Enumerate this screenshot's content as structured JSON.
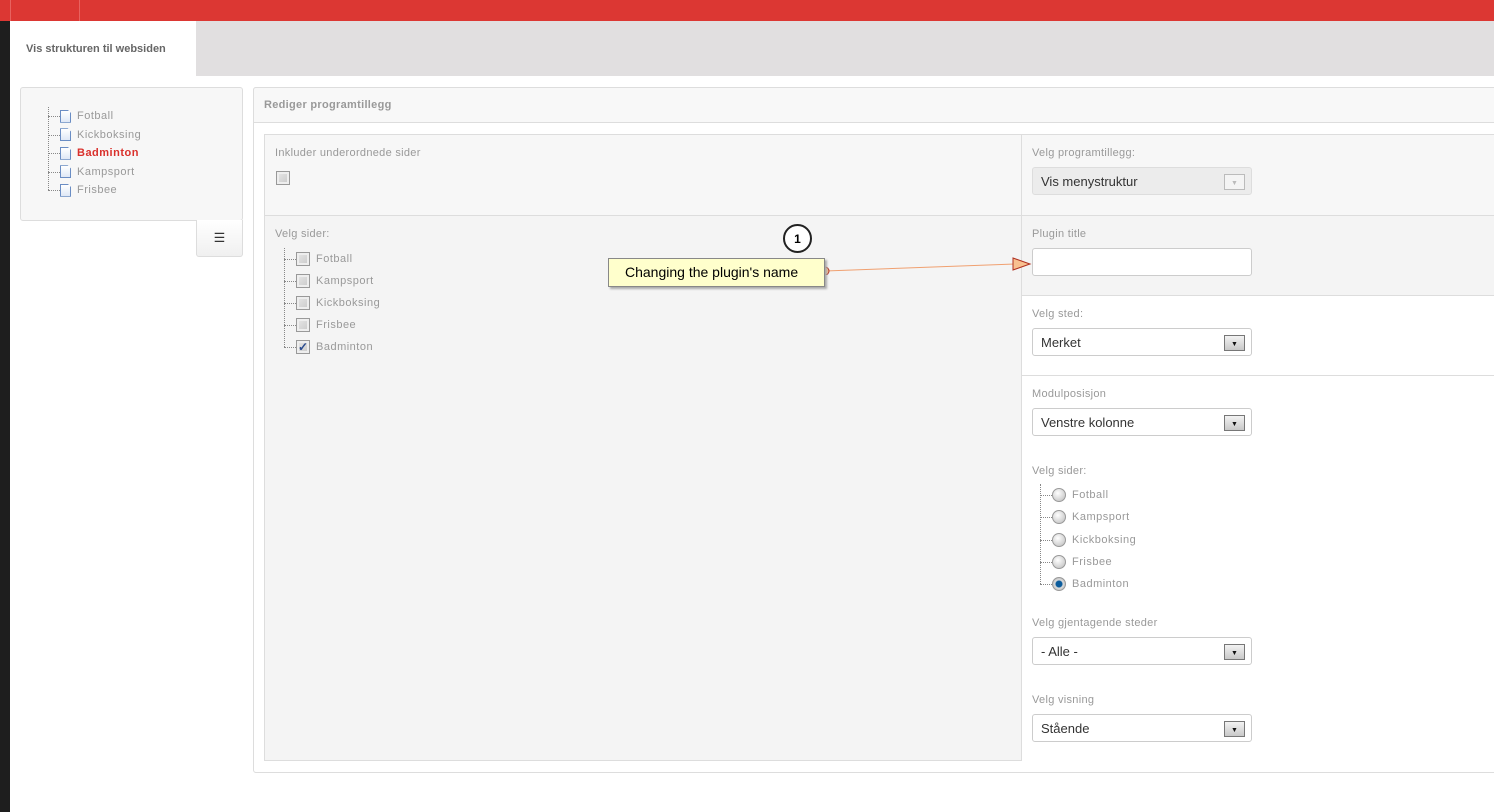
{
  "tab": {
    "label": "Vis strukturen til websiden"
  },
  "tree": {
    "items": [
      {
        "label": "Fotball",
        "active": false
      },
      {
        "label": "Kickboksing",
        "active": false
      },
      {
        "label": "Badminton",
        "active": true
      },
      {
        "label": "Kampsport",
        "active": false
      },
      {
        "label": "Frisbee",
        "active": false
      }
    ]
  },
  "panel": {
    "title": "Rediger programtillegg"
  },
  "left": {
    "include_label": "Inkluder underordnede sider",
    "include_checked": false,
    "pages_label": "Velg sider:",
    "pages": [
      {
        "label": "Fotball",
        "checked": false
      },
      {
        "label": "Kampsport",
        "checked": false
      },
      {
        "label": "Kickboksing",
        "checked": false
      },
      {
        "label": "Frisbee",
        "checked": false
      },
      {
        "label": "Badminton",
        "checked": true
      }
    ]
  },
  "right": {
    "plugin_label": "Velg programtillegg:",
    "plugin_value": "Vis menystruktur",
    "title_label": "Plugin title",
    "title_value": "",
    "place_label": "Velg sted:",
    "place_value": "Merket",
    "position_label": "Modulposisjon",
    "position_value": "Venstre kolonne",
    "pages_label": "Velg sider:",
    "pages": [
      {
        "label": "Fotball",
        "selected": false
      },
      {
        "label": "Kampsport",
        "selected": false
      },
      {
        "label": "Kickboksing",
        "selected": false
      },
      {
        "label": "Frisbee",
        "selected": false
      },
      {
        "label": "Badminton",
        "selected": true
      }
    ],
    "repeat_label": "Velg gjentagende steder",
    "repeat_value": "- Alle -",
    "view_label": "Velg visning",
    "view_value": "Stående"
  },
  "annotation": {
    "number": "1",
    "text": "Changing the plugin's name"
  }
}
